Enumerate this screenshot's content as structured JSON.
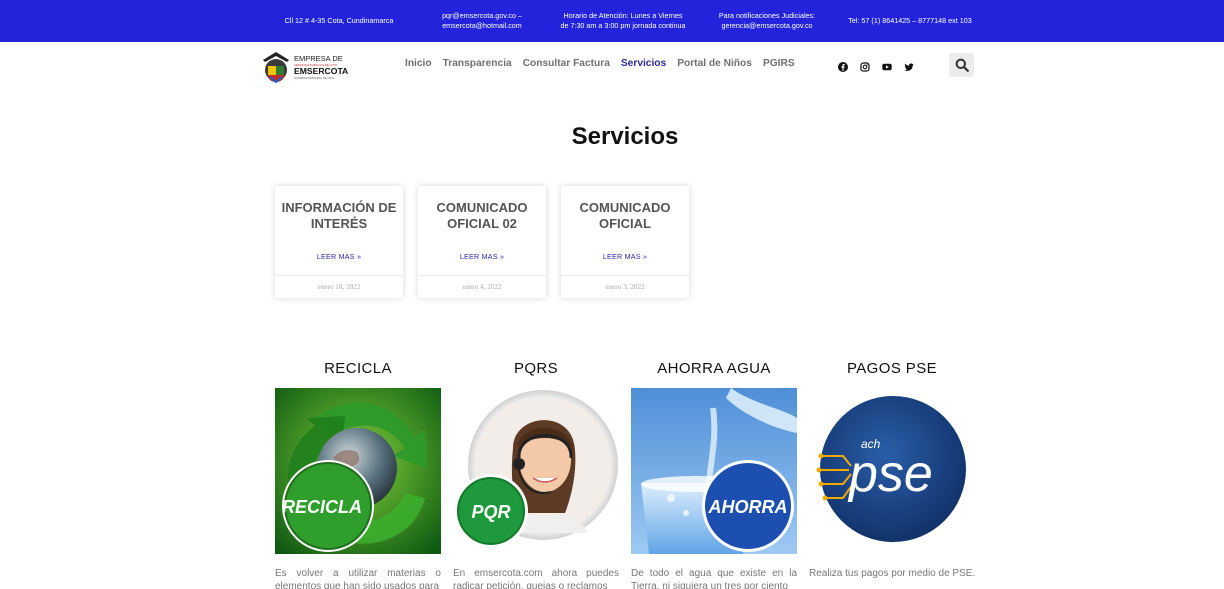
{
  "topbar": {
    "address": "Cll 12 # 4-35 Cota, Cundinamarca",
    "email_1": "pqr@emsercota.gov.co –",
    "email_2": "emsercota@hotmail.com",
    "hours_1": "Horario de Atención: Lunes a Viernes",
    "hours_2": "de 7:30 am a 3:00 pm jornada continua",
    "judicial_1": "Para notificaciones Judiciales:",
    "judicial_2": "gerencia@emsercota.gov.co",
    "phone": "Tel: 57 (1) 8641425 – 8777148 ext 103",
    "background": "#2323dc"
  },
  "logo": {
    "line1": "EMPRESA DE",
    "line2": "SERVICIOS PUBLICOS DE COTA",
    "line3": "EMSERCOTA",
    "line4": "SOCIEDAD MUNICIPAL DE COTA"
  },
  "nav": {
    "items": [
      "Inicio",
      "Transparencia",
      "Consultar Factura",
      "Servicios",
      "Portal de Niños",
      "PGIRS"
    ],
    "active": "Servicios",
    "active_color": "#2a2a9a"
  },
  "social": [
    "facebook-icon",
    "instagram-icon",
    "youtube-icon",
    "twitter-icon"
  ],
  "page": {
    "title": "Servicios"
  },
  "cards": [
    {
      "title": "INFORMACIÓN DE INTERÉS",
      "more": "LEER MAS »",
      "date": "enero 18, 2022"
    },
    {
      "title": "COMUNICADO OFICIAL 02",
      "more": "LEER MAS »",
      "date": "enero 4, 2022"
    },
    {
      "title": "COMUNICADO OFICIAL",
      "more": "LEER MAS »",
      "date": "enero 3, 2022"
    }
  ],
  "services": [
    {
      "title": "RECICLA",
      "badge": "RECICLA",
      "text": "Es volver a utilizar materias o elementos que han sido usados para"
    },
    {
      "title": "PQRS",
      "badge": "PQR",
      "text": "En emsercota.com ahora puedes radicar petición, quejas o reclamos"
    },
    {
      "title": "AHORRA AGUA",
      "badge": "AHORRA",
      "text": "De todo el agua que existe en la Tierra, ni siquiera un tres por ciento"
    },
    {
      "title": "PAGOS PSE",
      "badge_small": "ach",
      "badge": "pse",
      "text": "Realiza tus pagos por medio de PSE."
    }
  ]
}
